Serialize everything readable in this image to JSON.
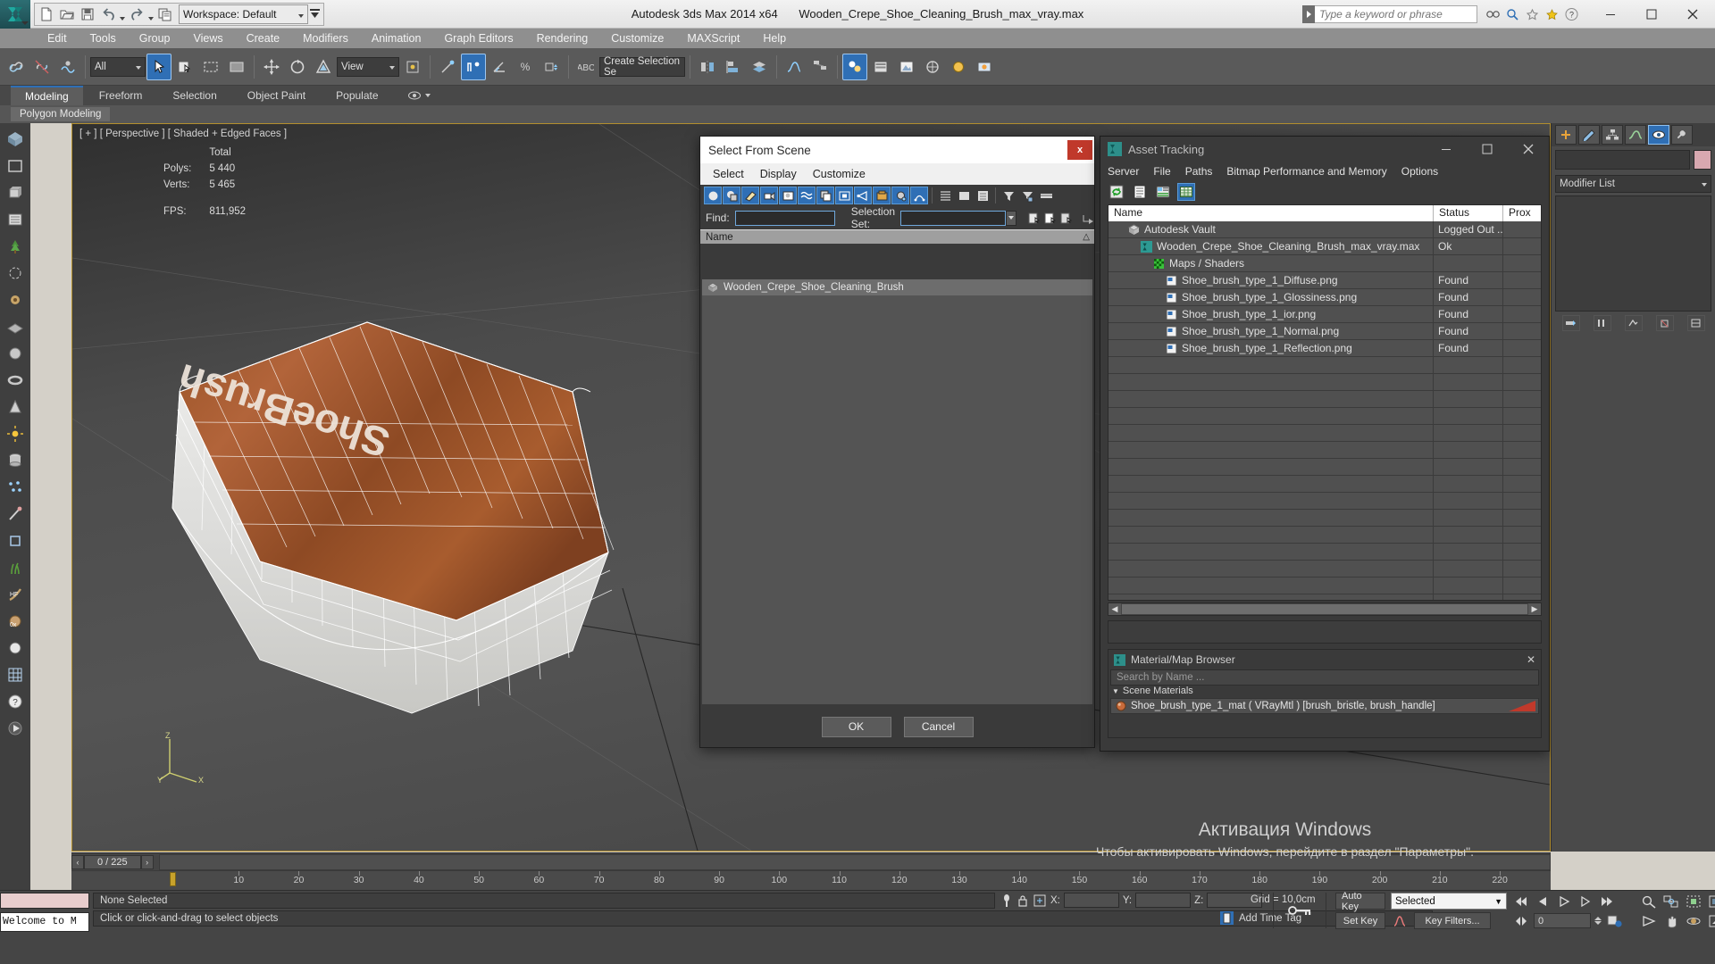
{
  "titlebar": {
    "workspace_label": "Workspace: Default",
    "app_title": "Autodesk 3ds Max  2014 x64",
    "file_title": "Wooden_Crepe_Shoe_Cleaning_Brush_max_vray.max",
    "search_placeholder": "Type a keyword or phrase",
    "qat": [
      "new-file-icon",
      "open-file-icon",
      "save-file-icon",
      "undo-icon",
      "redo-icon",
      "project-folder-icon"
    ],
    "window_buttons": [
      "minimize",
      "maximize",
      "close"
    ]
  },
  "menubar": {
    "items": [
      "Edit",
      "Tools",
      "Group",
      "Views",
      "Create",
      "Modifiers",
      "Animation",
      "Graph Editors",
      "Rendering",
      "Customize",
      "MAXScript",
      "Help"
    ]
  },
  "maintoolbar": {
    "filter_value": "All",
    "view_value": "View",
    "selection_set_placeholder": "Create Selection Se",
    "named_selection_label": "Create Selection Se"
  },
  "ribbon": {
    "tabs": [
      "Modeling",
      "Freeform",
      "Selection",
      "Object Paint",
      "Populate"
    ],
    "active_tab": "Modeling",
    "subtab": "Polygon Modeling"
  },
  "viewport": {
    "label": "[ + ] [ Perspective ] [ Shaded + Edged Faces ]",
    "stats": {
      "total_header": "Total",
      "polys_label": "Polys:",
      "polys_value": "5 440",
      "verts_label": "Verts:",
      "verts_value": "5 465",
      "fps_label": "FPS:",
      "fps_value": "811,952"
    },
    "object_text": "ShoeBrush",
    "axis": {
      "z": "Z",
      "x": "X",
      "y": "Y"
    }
  },
  "select_from_scene": {
    "title": "Select From Scene",
    "close_label": "x",
    "menu": [
      "Select",
      "Display",
      "Customize"
    ],
    "find_label": "Find:",
    "find_value": "",
    "selection_set_label": "Selection Set:",
    "selection_set_value": "",
    "column_name": "Name",
    "rows": [
      {
        "label": "Wooden_Crepe_Shoe_Cleaning_Brush",
        "icon": "mesh-object-icon",
        "selected": true
      }
    ],
    "ok_label": "OK",
    "cancel_label": "Cancel",
    "toolbar_icons": [
      "geometry-filter-icon",
      "shapes-filter-icon",
      "lights-filter-icon",
      "cameras-filter-icon",
      "helpers-filter-icon",
      "space-warps-filter-icon",
      "groups-filter-icon",
      "xrefs-filter-icon",
      "bones-filter-icon",
      "containers-filter-icon",
      "display-children-icon",
      "influences-icon",
      "expand-all-icon",
      "collapse-all-icon",
      "list-types-icon",
      "sort-alpha-icon",
      "filter-icon",
      "filter-selected-icon",
      "pick-list-icon"
    ]
  },
  "asset_tracking": {
    "title": "Asset Tracking",
    "menu": [
      "Server",
      "File",
      "Paths",
      "Bitmap Performance and Memory",
      "Options"
    ],
    "toolbar_icons": [
      "refresh-icon",
      "list-view-icon",
      "path-editor-icon",
      "grid-view-icon"
    ],
    "columns": [
      "Name",
      "Status",
      "Prox"
    ],
    "rows": [
      {
        "name": "Autodesk Vault",
        "status": "Logged Out ...",
        "prox": "",
        "indent": 1,
        "icon": "vault-icon"
      },
      {
        "name": "Wooden_Crepe_Shoe_Cleaning_Brush_max_vray.max",
        "status": "Ok",
        "prox": "",
        "indent": 2,
        "icon": "max-file-icon"
      },
      {
        "name": "Maps / Shaders",
        "status": "",
        "prox": "",
        "indent": 3,
        "icon": "maps-shaders-icon"
      },
      {
        "name": "Shoe_brush_type_1_Diffuse.png",
        "status": "Found",
        "prox": "",
        "indent": 4,
        "icon": "bitmap-icon"
      },
      {
        "name": "Shoe_brush_type_1_Glossiness.png",
        "status": "Found",
        "prox": "",
        "indent": 4,
        "icon": "bitmap-icon"
      },
      {
        "name": "Shoe_brush_type_1_ior.png",
        "status": "Found",
        "prox": "",
        "indent": 4,
        "icon": "bitmap-icon"
      },
      {
        "name": "Shoe_brush_type_1_Normal.png",
        "status": "Found",
        "prox": "",
        "indent": 4,
        "icon": "bitmap-icon"
      },
      {
        "name": "Shoe_brush_type_1_Reflection.png",
        "status": "Found",
        "prox": "",
        "indent": 4,
        "icon": "bitmap-icon"
      }
    ],
    "empty_row_count": 16
  },
  "material_browser": {
    "title": "Material/Map Browser",
    "close_label": "✕",
    "search_placeholder": "Search by Name ...",
    "section_label": "Scene Materials",
    "items": [
      {
        "label": "Shoe_brush_type_1_mat  ( VRayMtl )  [brush_bristle, brush_handle]",
        "swatch_color": "#c0392b"
      }
    ]
  },
  "right_panel": {
    "modifier_list_label": "Modifier List",
    "tabs": [
      "create-tab",
      "modify-tab",
      "hierarchy-tab",
      "motion-tab",
      "display-tab",
      "utilities-tab"
    ]
  },
  "timeline": {
    "frame_field": "0 / 225",
    "prev_label": "‹",
    "next_label": "›",
    "ticks": [
      "10",
      "20",
      "30",
      "40",
      "50",
      "60",
      "70",
      "80",
      "90",
      "100",
      "110",
      "120",
      "130",
      "140",
      "150",
      "160",
      "170",
      "180",
      "190",
      "200",
      "210",
      "220"
    ]
  },
  "statusbar": {
    "mini_listener_text": "Welcome to M",
    "selection_status": "None Selected",
    "prompt": "Click or click-and-drag to select objects",
    "x_label": "X:",
    "y_label": "Y:",
    "z_label": "Z:",
    "x_value": "",
    "y_value": "",
    "z_value": "",
    "grid_label": "Grid = 10,0cm",
    "add_time_tag": "Add Time Tag",
    "auto_key": "Auto Key",
    "set_key": "Set Key",
    "key_mode_value": "Selected",
    "key_filters": "Key Filters...",
    "current_frame": "0"
  },
  "watermark": {
    "line1": "Активация Windows",
    "line2": "Чтобы активировать Windows, перейдите в раздел \"Параметры\"."
  },
  "colors": {
    "accent_blue": "#2f6fb5",
    "viewport_border": "#b38f2e",
    "close_red": "#c0392b",
    "wood": "#8a4a26"
  }
}
